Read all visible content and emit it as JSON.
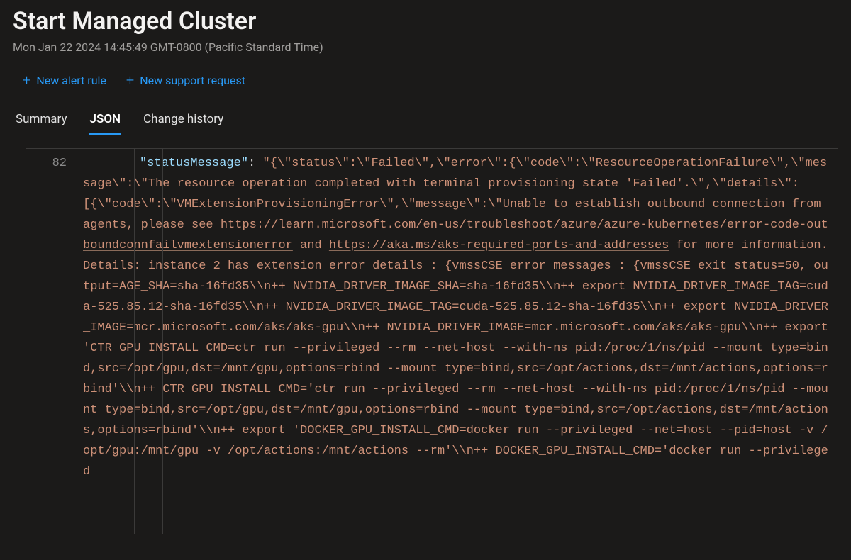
{
  "header": {
    "title": "Start Managed Cluster",
    "timestamp": "Mon Jan 22 2024 14:45:49 GMT-0800 (Pacific Standard Time)"
  },
  "toolbar": {
    "new_alert_rule": "New alert rule",
    "new_support_request": "New support request"
  },
  "tabs": {
    "summary": "Summary",
    "json": "JSON",
    "change_history": "Change history",
    "active": "json"
  },
  "code": {
    "line_number": "82",
    "key": "\"statusMessage\"",
    "value_pre": "\"{\\\"status\\\":\\\"Failed\\\",\\\"error\\\":{\\\"code\\\":\\\"ResourceOperationFailure\\\",\\\"message\\\":\\\"The resource operation completed with terminal provisioning state 'Failed'.\\\",\\\"details\\\":[{\\\"code\\\":\\\"VMExtensionProvisioningError\\\",\\\"message\\\":\\\"Unable to establish outbound connection from agents, please see ",
    "link1": "https://learn.microsoft.com/en-us/troubleshoot/azure/azure-kubernetes/error-code-outboundconnfailvmextensionerror",
    "mid1": " and ",
    "link2": "https://aka.ms/aks-required-ports-and-addresses",
    "value_post": " for more information. Details: instance 2 has extension error details : {vmssCSE error messages : {vmssCSE exit status=50, output=AGE_SHA=sha-16fd35\\\\n++ NVIDIA_DRIVER_IMAGE_SHA=sha-16fd35\\\\n++ export NVIDIA_DRIVER_IMAGE_TAG=cuda-525.85.12-sha-16fd35\\\\n++ NVIDIA_DRIVER_IMAGE_TAG=cuda-525.85.12-sha-16fd35\\\\n++ export NVIDIA_DRIVER_IMAGE=mcr.microsoft.com/aks/aks-gpu\\\\n++ NVIDIA_DRIVER_IMAGE=mcr.microsoft.com/aks/aks-gpu\\\\n++ export 'CTR_GPU_INSTALL_CMD=ctr run --privileged --rm --net-host --with-ns pid:/proc/1/ns/pid --mount type=bind,src=/opt/gpu,dst=/mnt/gpu,options=rbind --mount type=bind,src=/opt/actions,dst=/mnt/actions,options=rbind'\\\\n++ CTR_GPU_INSTALL_CMD='ctr run --privileged --rm --net-host --with-ns pid:/proc/1/ns/pid --mount type=bind,src=/opt/gpu,dst=/mnt/gpu,options=rbind --mount type=bind,src=/opt/actions,dst=/mnt/actions,options=rbind'\\\\n++ export 'DOCKER_GPU_INSTALL_CMD=docker run --privileged --net=host --pid=host -v /opt/gpu:/mnt/gpu -v /opt/actions:/mnt/actions --rm'\\\\n++ DOCKER_GPU_INSTALL_CMD='docker run --privileged"
  }
}
